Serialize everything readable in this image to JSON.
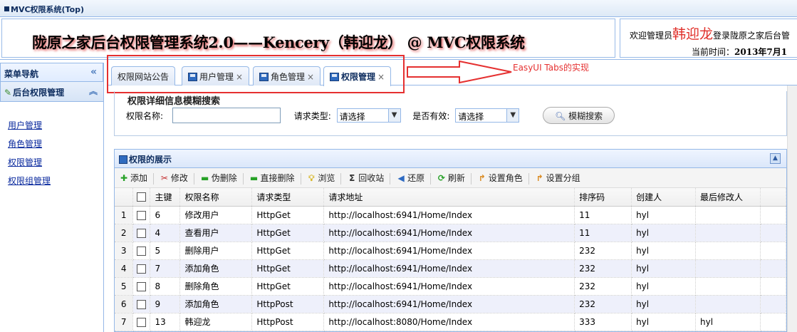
{
  "window": {
    "title": "MVC权限系统(Top)"
  },
  "header": {
    "banner": "陇原之家后台权限管理系统2.0——Kencery（韩迎龙） @ MVC权限系统",
    "welcome_prefix": "欢迎管理员",
    "welcome_name": "韩迎龙",
    "welcome_suffix": "登录陇原之家后台管",
    "time_label": "当前时间：",
    "time_value": "2013年7月1"
  },
  "sidebar": {
    "title": "菜单导航",
    "section": "后台权限管理",
    "items": [
      {
        "label": "用户管理"
      },
      {
        "label": "角色管理"
      },
      {
        "label": "权限管理"
      },
      {
        "label": "权限组管理"
      }
    ]
  },
  "tabs": [
    {
      "label": "权限网站公告",
      "closable": false,
      "icon": ""
    },
    {
      "label": "用户管理",
      "closable": true,
      "icon": "disk-icon"
    },
    {
      "label": "角色管理",
      "closable": true,
      "icon": "disk-icon"
    },
    {
      "label": "权限管理",
      "closable": true,
      "icon": "disk-icon",
      "active": true
    }
  ],
  "annotation": {
    "text": "EasyUI Tabs的实现",
    "color": "#e53030"
  },
  "search": {
    "title": "权限详细信息模糊搜索",
    "name_label": "权限名称:",
    "name_value": "",
    "request_type_label": "请求类型:",
    "request_type_value": "请选择",
    "valid_label": "是否有效:",
    "valid_value": "请选择",
    "button": "模糊搜索"
  },
  "grid": {
    "title": "权限的展示",
    "toolbar": [
      {
        "label": "添加",
        "icon": "add-icon"
      },
      {
        "label": "修改",
        "icon": "cut-icon"
      },
      {
        "label": "伪删除",
        "icon": "remove-icon"
      },
      {
        "label": "直接删除",
        "icon": "remove-icon"
      },
      {
        "label": "浏览",
        "icon": "lightbulb-icon"
      },
      {
        "label": "回收站",
        "icon": "sigma-icon"
      },
      {
        "label": "还原",
        "icon": "back-icon"
      },
      {
        "label": "刷新",
        "icon": "reload-icon"
      },
      {
        "label": "设置角色",
        "icon": "redo-icon"
      },
      {
        "label": "设置分组",
        "icon": "redo-icon"
      }
    ],
    "columns": [
      "主键",
      "权限名称",
      "请求类型",
      "请求地址",
      "排序码",
      "创建人",
      "最后修改人"
    ],
    "rows": [
      {
        "n": "1",
        "id": "6",
        "name": "修改用户",
        "type": "HttpGet",
        "url": "http://localhost:6941/Home/Index",
        "sort": "11",
        "creator": "hyl",
        "modifier": ""
      },
      {
        "n": "2",
        "id": "4",
        "name": "查看用户",
        "type": "HttpGet",
        "url": "http://localhost:6941/Home/Index",
        "sort": "11",
        "creator": "hyl",
        "modifier": ""
      },
      {
        "n": "3",
        "id": "5",
        "name": "删除用户",
        "type": "HttpGet",
        "url": "http://localhost:6941/Home/Index",
        "sort": "232",
        "creator": "hyl",
        "modifier": ""
      },
      {
        "n": "4",
        "id": "7",
        "name": "添加角色",
        "type": "HttpGet",
        "url": "http://localhost:6941/Home/Index",
        "sort": "232",
        "creator": "hyl",
        "modifier": ""
      },
      {
        "n": "5",
        "id": "8",
        "name": "删除角色",
        "type": "HttpGet",
        "url": "http://localhost:6941/Home/Index",
        "sort": "232",
        "creator": "hyl",
        "modifier": ""
      },
      {
        "n": "6",
        "id": "9",
        "name": "添加角色",
        "type": "HttpPost",
        "url": "http://localhost:6941/Home/Index",
        "sort": "232",
        "creator": "hyl",
        "modifier": ""
      },
      {
        "n": "7",
        "id": "13",
        "name": "韩迎龙",
        "type": "HttpPost",
        "url": "http://localhost:8080/Home/Index",
        "sort": "333",
        "creator": "hyl",
        "modifier": "hyl"
      }
    ]
  }
}
